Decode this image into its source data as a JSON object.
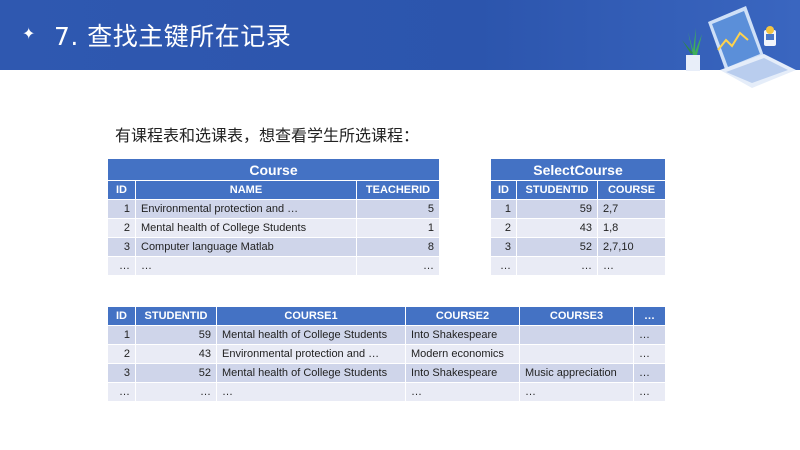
{
  "header": {
    "bullet": "✦",
    "title": "7. 查找主键所在记录"
  },
  "intro": "有课程表和选课表，想查看学生所选课程：",
  "course_table": {
    "caption": "Course",
    "columns": [
      "ID",
      "NAME",
      "TEACHERID"
    ],
    "rows": [
      [
        "1",
        "Environmental protection and …",
        "5"
      ],
      [
        "2",
        "Mental health of College Students",
        "1"
      ],
      [
        "3",
        "Computer language Matlab",
        "8"
      ],
      [
        "…",
        "…",
        "…"
      ]
    ]
  },
  "select_table": {
    "caption": "SelectCourse",
    "columns": [
      "ID",
      "STUDENTID",
      "COURSE"
    ],
    "rows": [
      [
        "1",
        "59",
        "2,7"
      ],
      [
        "2",
        "43",
        "1,8"
      ],
      [
        "3",
        "52",
        "2,7,10"
      ],
      [
        "…",
        "…",
        "…"
      ]
    ]
  },
  "result_table": {
    "columns": [
      "ID",
      "STUDENTID",
      "COURSE1",
      "COURSE2",
      "COURSE3",
      "…"
    ],
    "rows": [
      [
        "1",
        "59",
        "Mental health of College Students",
        "Into Shakespeare",
        "",
        "…"
      ],
      [
        "2",
        "43",
        "Environmental protection and …",
        "Modern economics",
        "",
        "…"
      ],
      [
        "3",
        "52",
        "Mental health of College Students",
        "Into Shakespeare",
        "Music appreciation",
        "…"
      ],
      [
        "…",
        "…",
        "…",
        "…",
        "…",
        "…"
      ]
    ]
  },
  "colors": {
    "header_blue": "#2f58b0",
    "table_blue": "#4472c4",
    "row_dark": "#cfd5ea",
    "row_light": "#e9ebf5"
  }
}
